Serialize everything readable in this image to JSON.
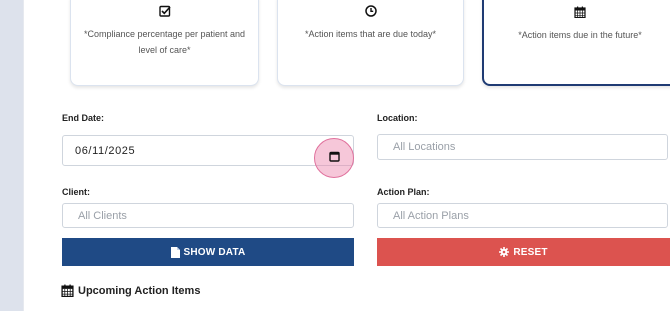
{
  "cards": [
    {
      "icon": "checkbox-icon",
      "text": "*Compliance percentage per patient and level of care*"
    },
    {
      "icon": "clock-icon",
      "text": "*Action items that are due today*"
    },
    {
      "icon": "calendar-icon",
      "text": "*Action items due in the future*"
    }
  ],
  "filters": {
    "end_date_label": "End Date:",
    "end_date_value": "06/11/2025",
    "location_label": "Location:",
    "location_placeholder": "All Locations",
    "client_label": "Client:",
    "client_placeholder": "All Clients",
    "action_plan_label": "Action Plan:",
    "action_plan_placeholder": "All Action Plans"
  },
  "buttons": {
    "show_data": "SHOW DATA",
    "reset": "RESET"
  },
  "section": {
    "title": "Upcoming Action Items"
  },
  "colors": {
    "primary": "#1f4a85",
    "danger": "#dc534f",
    "active_border": "#1f3b73",
    "highlight": "#e0709c"
  }
}
